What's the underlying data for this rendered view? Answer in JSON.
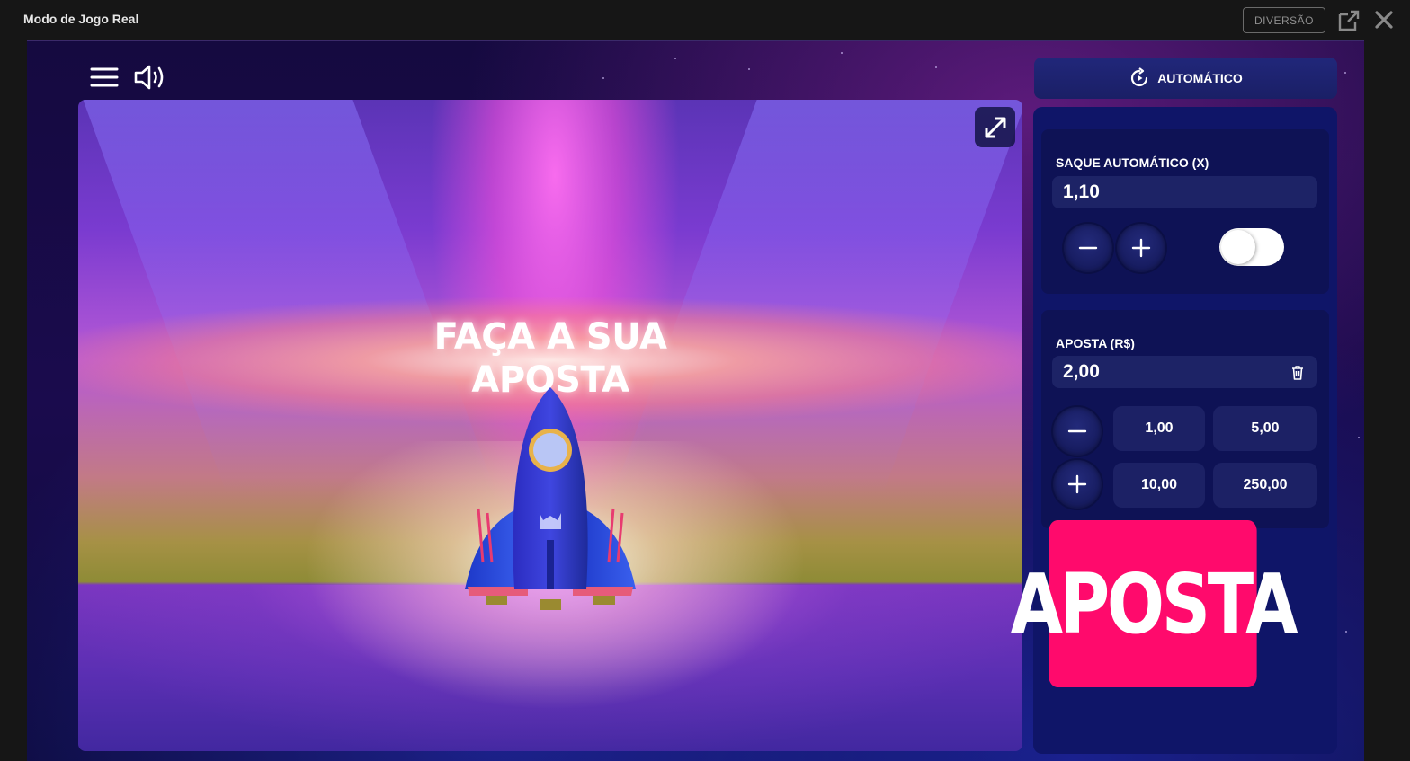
{
  "window": {
    "title": "Modo de Jogo Real",
    "fun_mode_label": "DIVERSÃO"
  },
  "stage": {
    "headline_line1": "FAÇA A SUA",
    "headline_line2": "APOSTA"
  },
  "panel": {
    "mode_tab_label": "AUTOMÁTICO",
    "auto_cashout": {
      "label": "SAQUE AUTOMÁTICO (X)",
      "value": "1,10",
      "toggle_on": false
    },
    "bet": {
      "label": "APOSTA (R$)",
      "value": "2,00",
      "quick_amounts": [
        "1,00",
        "5,00",
        "10,00",
        "250,00"
      ]
    },
    "bet_button_label": "APOSTA"
  },
  "colors": {
    "accent_pink": "#ff0a6c",
    "panel_bg": "#0f1568",
    "field_bg": "#1d2366"
  },
  "icons": [
    "external-link-icon",
    "close-icon",
    "menu-icon",
    "sound-icon",
    "expand-icon",
    "auto-play-icon",
    "minus-icon",
    "plus-icon",
    "trash-icon"
  ]
}
